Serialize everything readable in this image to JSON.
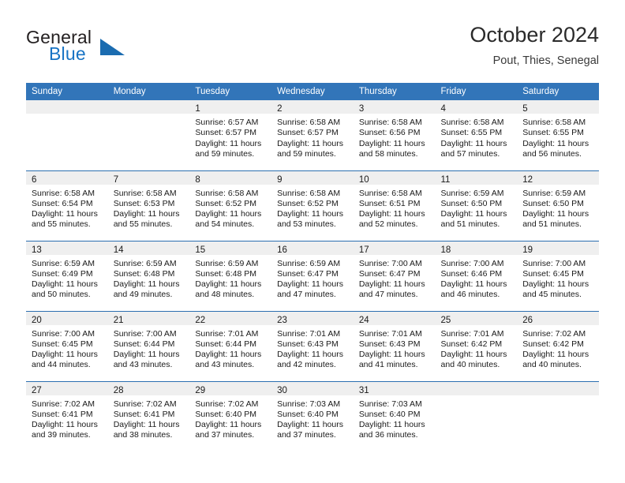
{
  "brand": {
    "name_part1": "General",
    "name_part2": "Blue",
    "triangle_icon": "triangle-icon",
    "accent_color": "#1773c4",
    "triangle_color": "#1b6cb0"
  },
  "header": {
    "title": "October 2024",
    "subtitle": "Pout, Thies, Senegal"
  },
  "theme": {
    "header_row_bg": "#3275b9",
    "week_separator": "#2c6fb0",
    "daynum_strip_bg": "#efefef",
    "text_color": "#1a1a1a"
  },
  "calendar": {
    "weekday_headers": [
      "Sunday",
      "Monday",
      "Tuesday",
      "Wednesday",
      "Thursday",
      "Friday",
      "Saturday"
    ],
    "weeks": [
      [
        {
          "day": "",
          "lines": []
        },
        {
          "day": "",
          "lines": []
        },
        {
          "day": "1",
          "lines": [
            "Sunrise: 6:57 AM",
            "Sunset: 6:57 PM",
            "Daylight: 11 hours",
            "and 59 minutes."
          ]
        },
        {
          "day": "2",
          "lines": [
            "Sunrise: 6:58 AM",
            "Sunset: 6:57 PM",
            "Daylight: 11 hours",
            "and 59 minutes."
          ]
        },
        {
          "day": "3",
          "lines": [
            "Sunrise: 6:58 AM",
            "Sunset: 6:56 PM",
            "Daylight: 11 hours",
            "and 58 minutes."
          ]
        },
        {
          "day": "4",
          "lines": [
            "Sunrise: 6:58 AM",
            "Sunset: 6:55 PM",
            "Daylight: 11 hours",
            "and 57 minutes."
          ]
        },
        {
          "day": "5",
          "lines": [
            "Sunrise: 6:58 AM",
            "Sunset: 6:55 PM",
            "Daylight: 11 hours",
            "and 56 minutes."
          ]
        }
      ],
      [
        {
          "day": "6",
          "lines": [
            "Sunrise: 6:58 AM",
            "Sunset: 6:54 PM",
            "Daylight: 11 hours",
            "and 55 minutes."
          ]
        },
        {
          "day": "7",
          "lines": [
            "Sunrise: 6:58 AM",
            "Sunset: 6:53 PM",
            "Daylight: 11 hours",
            "and 55 minutes."
          ]
        },
        {
          "day": "8",
          "lines": [
            "Sunrise: 6:58 AM",
            "Sunset: 6:52 PM",
            "Daylight: 11 hours",
            "and 54 minutes."
          ]
        },
        {
          "day": "9",
          "lines": [
            "Sunrise: 6:58 AM",
            "Sunset: 6:52 PM",
            "Daylight: 11 hours",
            "and 53 minutes."
          ]
        },
        {
          "day": "10",
          "lines": [
            "Sunrise: 6:58 AM",
            "Sunset: 6:51 PM",
            "Daylight: 11 hours",
            "and 52 minutes."
          ]
        },
        {
          "day": "11",
          "lines": [
            "Sunrise: 6:59 AM",
            "Sunset: 6:50 PM",
            "Daylight: 11 hours",
            "and 51 minutes."
          ]
        },
        {
          "day": "12",
          "lines": [
            "Sunrise: 6:59 AM",
            "Sunset: 6:50 PM",
            "Daylight: 11 hours",
            "and 51 minutes."
          ]
        }
      ],
      [
        {
          "day": "13",
          "lines": [
            "Sunrise: 6:59 AM",
            "Sunset: 6:49 PM",
            "Daylight: 11 hours",
            "and 50 minutes."
          ]
        },
        {
          "day": "14",
          "lines": [
            "Sunrise: 6:59 AM",
            "Sunset: 6:48 PM",
            "Daylight: 11 hours",
            "and 49 minutes."
          ]
        },
        {
          "day": "15",
          "lines": [
            "Sunrise: 6:59 AM",
            "Sunset: 6:48 PM",
            "Daylight: 11 hours",
            "and 48 minutes."
          ]
        },
        {
          "day": "16",
          "lines": [
            "Sunrise: 6:59 AM",
            "Sunset: 6:47 PM",
            "Daylight: 11 hours",
            "and 47 minutes."
          ]
        },
        {
          "day": "17",
          "lines": [
            "Sunrise: 7:00 AM",
            "Sunset: 6:47 PM",
            "Daylight: 11 hours",
            "and 47 minutes."
          ]
        },
        {
          "day": "18",
          "lines": [
            "Sunrise: 7:00 AM",
            "Sunset: 6:46 PM",
            "Daylight: 11 hours",
            "and 46 minutes."
          ]
        },
        {
          "day": "19",
          "lines": [
            "Sunrise: 7:00 AM",
            "Sunset: 6:45 PM",
            "Daylight: 11 hours",
            "and 45 minutes."
          ]
        }
      ],
      [
        {
          "day": "20",
          "lines": [
            "Sunrise: 7:00 AM",
            "Sunset: 6:45 PM",
            "Daylight: 11 hours",
            "and 44 minutes."
          ]
        },
        {
          "day": "21",
          "lines": [
            "Sunrise: 7:00 AM",
            "Sunset: 6:44 PM",
            "Daylight: 11 hours",
            "and 43 minutes."
          ]
        },
        {
          "day": "22",
          "lines": [
            "Sunrise: 7:01 AM",
            "Sunset: 6:44 PM",
            "Daylight: 11 hours",
            "and 43 minutes."
          ]
        },
        {
          "day": "23",
          "lines": [
            "Sunrise: 7:01 AM",
            "Sunset: 6:43 PM",
            "Daylight: 11 hours",
            "and 42 minutes."
          ]
        },
        {
          "day": "24",
          "lines": [
            "Sunrise: 7:01 AM",
            "Sunset: 6:43 PM",
            "Daylight: 11 hours",
            "and 41 minutes."
          ]
        },
        {
          "day": "25",
          "lines": [
            "Sunrise: 7:01 AM",
            "Sunset: 6:42 PM",
            "Daylight: 11 hours",
            "and 40 minutes."
          ]
        },
        {
          "day": "26",
          "lines": [
            "Sunrise: 7:02 AM",
            "Sunset: 6:42 PM",
            "Daylight: 11 hours",
            "and 40 minutes."
          ]
        }
      ],
      [
        {
          "day": "27",
          "lines": [
            "Sunrise: 7:02 AM",
            "Sunset: 6:41 PM",
            "Daylight: 11 hours",
            "and 39 minutes."
          ]
        },
        {
          "day": "28",
          "lines": [
            "Sunrise: 7:02 AM",
            "Sunset: 6:41 PM",
            "Daylight: 11 hours",
            "and 38 minutes."
          ]
        },
        {
          "day": "29",
          "lines": [
            "Sunrise: 7:02 AM",
            "Sunset: 6:40 PM",
            "Daylight: 11 hours",
            "and 37 minutes."
          ]
        },
        {
          "day": "30",
          "lines": [
            "Sunrise: 7:03 AM",
            "Sunset: 6:40 PM",
            "Daylight: 11 hours",
            "and 37 minutes."
          ]
        },
        {
          "day": "31",
          "lines": [
            "Sunrise: 7:03 AM",
            "Sunset: 6:40 PM",
            "Daylight: 11 hours",
            "and 36 minutes."
          ]
        },
        {
          "day": "",
          "lines": []
        },
        {
          "day": "",
          "lines": []
        }
      ]
    ]
  }
}
